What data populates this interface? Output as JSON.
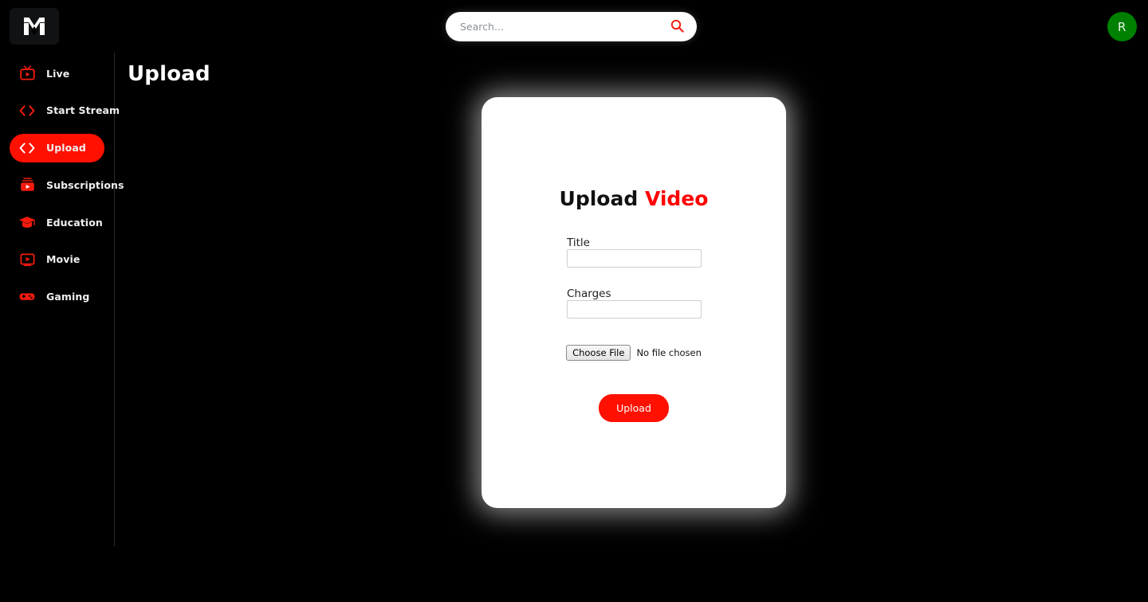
{
  "topbar": {
    "logo_name": "mitra-logo",
    "search": {
      "placeholder": "Search...",
      "value": "",
      "icon": "search-icon"
    },
    "avatar": {
      "initial": "R",
      "color": "#008000"
    }
  },
  "sidebar": {
    "items": [
      {
        "label": "Live",
        "icon": "live-tv-icon",
        "active": false
      },
      {
        "label": "Start Stream",
        "icon": "code-brackets-icon",
        "active": false
      },
      {
        "label": "Upload",
        "icon": "code-brackets-icon",
        "active": true
      },
      {
        "label": "Subscriptions",
        "icon": "subscriptions-icon",
        "active": false
      },
      {
        "label": "Education",
        "icon": "graduation-cap-icon",
        "active": false
      },
      {
        "label": "Movie",
        "icon": "movie-play-icon",
        "active": false
      },
      {
        "label": "Gaming",
        "icon": "gamepad-icon",
        "active": false
      }
    ],
    "accent": "#ff1000"
  },
  "main": {
    "page_title": "Upload"
  },
  "modal": {
    "title_primary": "Upload",
    "title_accent": "Video",
    "accent_color": "#ff0000",
    "fields": [
      {
        "label": "Title",
        "value": "",
        "placeholder": ""
      },
      {
        "label": "Charges",
        "value": "",
        "placeholder": ""
      }
    ],
    "file_input": {
      "button_label": "Choose File",
      "status_text": "No file chosen"
    },
    "submit_label": "Upload"
  },
  "floating": {
    "close_icon": "close-x-icon",
    "image_icon": "image-placeholder-icon"
  }
}
